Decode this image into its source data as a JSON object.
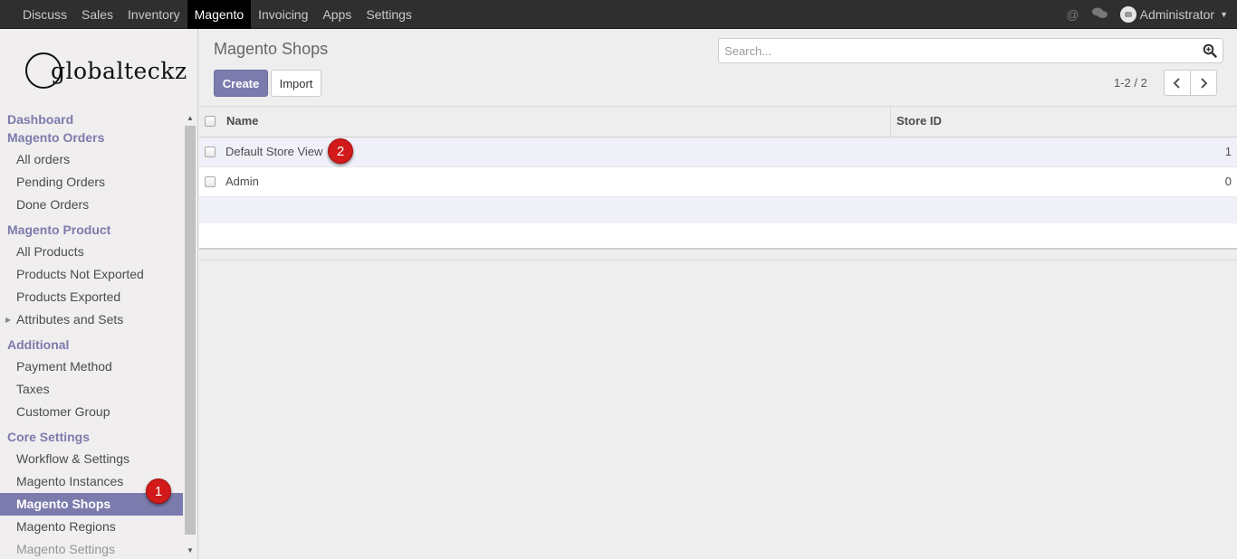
{
  "menu": {
    "items": [
      "Discuss",
      "Sales",
      "Inventory",
      "Magento",
      "Invoicing",
      "Apps",
      "Settings"
    ],
    "active": "Magento"
  },
  "systray": {
    "mention_icon": "at-icon",
    "chat_icon": "chat-bubbles-icon",
    "user_name": "Administrator"
  },
  "logo_text": "globalteckz",
  "sidebar": {
    "dashboard": "Dashboard",
    "orders_section": "Magento Orders",
    "all_orders": "All orders",
    "pending_orders": "Pending Orders",
    "done_orders": "Done Orders",
    "product_section": "Magento Product",
    "all_products": "All Products",
    "products_not_exported": "Products Not Exported",
    "products_exported": "Products Exported",
    "attributes_and_sets": "Attributes and Sets",
    "additional_section": "Additional",
    "payment_method": "Payment Method",
    "taxes": "Taxes",
    "customer_group": "Customer Group",
    "core_section": "Core Settings",
    "workflow_settings": "Workflow & Settings",
    "magento_instances": "Magento Instances",
    "magento_shops": "Magento Shops",
    "magento_regions": "Magento Regions",
    "magento_settings": "Magento Settings"
  },
  "annotations": {
    "badge1": "1",
    "badge2": "2"
  },
  "control_panel": {
    "title": "Magento Shops",
    "create_label": "Create",
    "import_label": "Import",
    "search_placeholder": "Search...",
    "pager": "1-2 / 2"
  },
  "table": {
    "columns": {
      "name": "Name",
      "store_id": "Store ID"
    },
    "rows": [
      {
        "name": "Default Store View",
        "store_id": "1"
      },
      {
        "name": "Admin",
        "store_id": "0"
      }
    ]
  },
  "colors": {
    "accent": "#7c7bad",
    "topbar": "#2f2f2f",
    "badge": "#d21a1a"
  }
}
